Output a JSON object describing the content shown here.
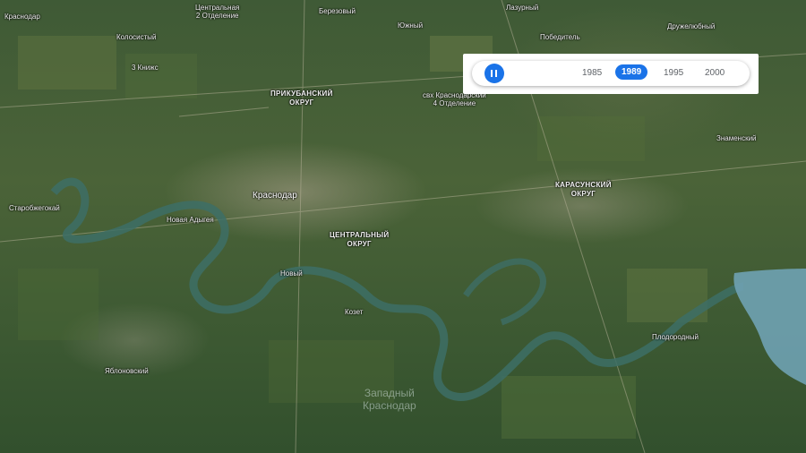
{
  "timeline": {
    "years": [
      "1985",
      "1989",
      "1995",
      "2000"
    ],
    "selected_year": "1989",
    "play_state": "paused"
  },
  "map": {
    "city": "Краснодар",
    "districts": {
      "prikubansky": [
        "ПРИКУБАНСКИЙ",
        "ОКРУГ"
      ],
      "karasunsky": [
        "КАРАСУНСКИЙ",
        "ОКРУГ"
      ],
      "central": [
        "ЦЕНТРАЛЬНЫЙ",
        "ОКРУГ"
      ]
    },
    "places": {
      "krasnodar_small": "Краснодар",
      "central_estate": "Центральная",
      "second_division": "2 Отделение",
      "berezovy": "Березовый",
      "yuzhny": "Южный",
      "kolosistyi": "Колосистый",
      "three_kings": "3 Книжс",
      "razumny": "Лазурный",
      "pobeditel": "Победитель",
      "druzhelyubny": "Дружелюбный",
      "krasnodarsky_sh": "свх Краснодарский",
      "fourth_division": "4 Отделение",
      "znamensky": "Знаменский",
      "starokorsunskaya": "Старобжегокай",
      "novaya_adygea": "Новая Адыгея",
      "novy": "Новый",
      "kozet": "Козет",
      "yablonovsky": "Яблоновский",
      "plodorodny": "Плодородный",
      "reservoir": [
        "Западный",
        "Краснодар"
      ]
    }
  }
}
